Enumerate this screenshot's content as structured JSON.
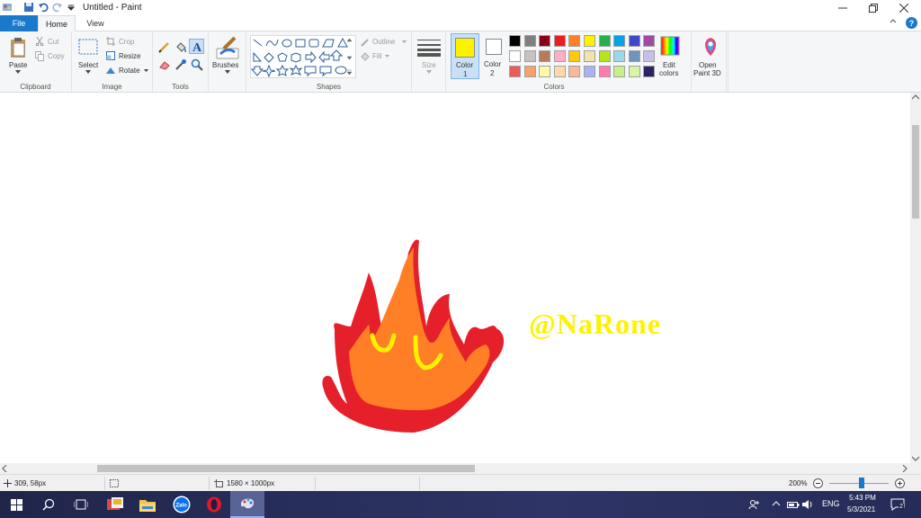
{
  "window": {
    "title": "Untitled - Paint",
    "minimize_icon": "minimize-icon",
    "maximize_icon": "restore-icon",
    "close_icon": "close-icon"
  },
  "tabs": [
    "File",
    "Home",
    "View"
  ],
  "ribbon": {
    "clipboard": {
      "group": "Clipboard",
      "paste": "Paste",
      "cut": "Cut",
      "copy": "Copy"
    },
    "image": {
      "group": "Image",
      "select": "Select",
      "crop": "Crop",
      "resize": "Resize",
      "rotate": "Rotate"
    },
    "tools": {
      "group": "Tools"
    },
    "brushes": {
      "label": "Brushes"
    },
    "shapes": {
      "group": "Shapes",
      "outline": "Outline",
      "fill": "Fill"
    },
    "size": {
      "label": "Size"
    },
    "colors": {
      "group": "Colors",
      "color1_label": "Color",
      "color1_num": "1",
      "color2_label": "Color",
      "color2_num": "2",
      "color1": "#fff200",
      "color2": "#ffffff",
      "edit_colors": "Edit",
      "edit_colors2": "colors",
      "paint3d": "Open",
      "paint3d2": "Paint 3D",
      "palette": [
        [
          "#000000",
          "#7f7f7f",
          "#880015",
          "#ed1c24",
          "#ff7f27",
          "#fff200",
          "#22b14c",
          "#00a2e8",
          "#3f48cc",
          "#a349a4"
        ],
        [
          "#ffffff",
          "#c3c3c3",
          "#b97a57",
          "#ffaec9",
          "#ffc90e",
          "#efe4b0",
          "#b5e61d",
          "#99d9ea",
          "#7092be",
          "#c8bfe7"
        ],
        [
          "#ed5a5a",
          "#f7a26b",
          "#fff9a8",
          "#ffd9a6",
          "#fbb89a",
          "#a8b4f0",
          "#ff7bac",
          "#c8f08a",
          "#d8f5a6",
          "#2b2464"
        ]
      ]
    }
  },
  "canvas": {
    "signature": "@NaRone",
    "signature_color": "#fff200"
  },
  "status": {
    "cursor_pos": "309, 58px",
    "canvas_size": "1580 × 1000px",
    "zoom": "200%"
  },
  "taskbar": {
    "tray_lang": "ENG",
    "time": "5:43 PM",
    "date": "5/3/2021",
    "notif_count": "2"
  }
}
